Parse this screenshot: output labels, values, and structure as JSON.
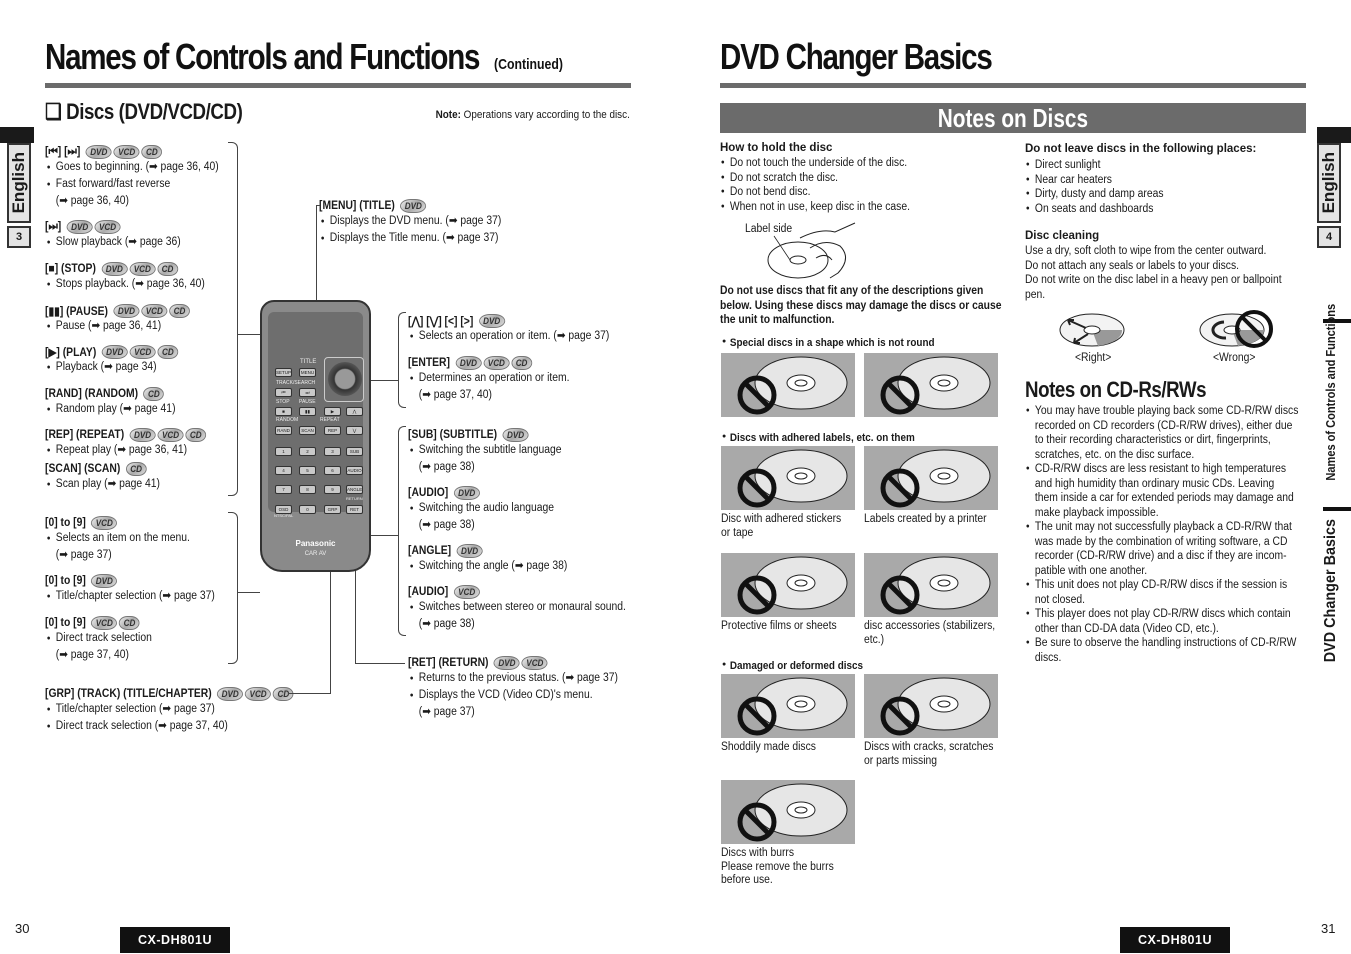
{
  "left_page": {
    "title": "Names of Controls and Functions",
    "title_suffix": "(Continued)",
    "section_title": "❑ Discs (DVD/VCD/CD)",
    "note_label": "Note:",
    "note_text": " Operations vary according to the disc.",
    "side_tab_label": "English",
    "side_tab_number": "3",
    "page_number": "30",
    "model": "CX-DH801U",
    "left_items": [
      {
        "key": "[⏮] [⏭]",
        "badges": [
          "DVD",
          "VCD",
          "CD"
        ],
        "bullets": [
          "Goes to beginning. (➡ page 36, 40)",
          "Fast forward/fast reverse",
          "(➡ page 36, 40)"
        ]
      },
      {
        "key": "[⏭]",
        "badges": [
          "DVD",
          "VCD"
        ],
        "bullets": [
          "Slow playback (➡ page 36)"
        ]
      },
      {
        "key": "[■] (STOP)",
        "badges": [
          "DVD",
          "VCD",
          "CD"
        ],
        "bullets": [
          "Stops playback. (➡ page 36, 40)"
        ]
      },
      {
        "key": "[▮▮] (PAUSE)",
        "badges": [
          "DVD",
          "VCD",
          "CD"
        ],
        "bullets": [
          "Pause (➡ page 36, 41)"
        ]
      },
      {
        "key": "[▶] (PLAY)",
        "badges": [
          "DVD",
          "VCD",
          "CD"
        ],
        "bullets": [
          "Playback (➡ page 34)"
        ]
      },
      {
        "key": "[RAND] (RANDOM)",
        "badges": [
          "CD"
        ],
        "bullets": [
          "Random play (➡ page 41)"
        ]
      },
      {
        "key": "[REP] (REPEAT)",
        "badges": [
          "DVD",
          "VCD",
          "CD"
        ],
        "bullets": [
          "Repeat play (➡ page 36, 41)"
        ]
      },
      {
        "key": "[SCAN] (SCAN)",
        "badges": [
          "CD"
        ],
        "bullets": [
          "Scan play (➡ page 41)"
        ]
      },
      {
        "key": "[0] to [9]",
        "badges": [
          "VCD"
        ],
        "bullets": [
          "Selects an item on the menu.",
          "(➡ page 37)"
        ]
      },
      {
        "key": "[0] to [9]",
        "badges": [
          "DVD"
        ],
        "bullets": [
          "Title/chapter selection (➡ page 37)"
        ]
      },
      {
        "key": "[0] to [9]",
        "badges": [
          "VCD",
          "CD"
        ],
        "bullets": [
          "Direct track selection",
          "(➡ page 37, 40)"
        ]
      },
      {
        "key": "[GRP] (TRACK) (TITLE/CHAPTER)",
        "badges": [
          "DVD",
          "VCD",
          "CD"
        ],
        "bullets": [
          "Title/chapter selection (➡ page 37)",
          "Direct track selection (➡ page 37, 40)"
        ]
      }
    ],
    "right_items": [
      {
        "key": "[MENU] (TITLE)",
        "badges": [
          "DVD"
        ],
        "bullets": [
          "Displays the DVD menu. (➡ page 37)",
          "Displays the Title menu. (➡ page 37)"
        ]
      },
      {
        "key": "[⋀] [⋁] [<] [>]",
        "badges": [
          "DVD"
        ],
        "bullets": [
          "Selects an operation or item. (➡ page 37)"
        ]
      },
      {
        "key": "[ENTER]",
        "badges": [
          "DVD",
          "VCD",
          "CD"
        ],
        "bullets": [
          "Determines an operation or item.",
          "(➡ page 37, 40)"
        ]
      },
      {
        "key": "[SUB] (SUBTITLE)",
        "badges": [
          "DVD"
        ],
        "bullets": [
          "Switching the subtitle language",
          "(➡ page 38)"
        ]
      },
      {
        "key": "[AUDIO]",
        "badges": [
          "DVD"
        ],
        "bullets": [
          "Switching the audio language",
          "(➡ page 38)"
        ]
      },
      {
        "key": "[ANGLE]",
        "badges": [
          "DVD"
        ],
        "bullets": [
          "Switching the angle (➡ page 38)"
        ]
      },
      {
        "key": "[AUDIO]",
        "badges": [
          "VCD"
        ],
        "bullets": [
          "Switches between stereo or monaural sound.",
          "(➡ page 38)"
        ]
      },
      {
        "key": "[RET] (RETURN)",
        "badges": [
          "DVD",
          "VCD"
        ],
        "bullets": [
          "Returns to the previous status. (➡ page 37)",
          "Displays the VCD (Video CD)'s menu.",
          "(➡ page 37)"
        ]
      }
    ],
    "remote": {
      "brand": "Panasonic",
      "sub": "CAR AV",
      "labels": {
        "title": "TITLE",
        "track_search": "TRACK/SEARCH",
        "stop": "STOP",
        "pause": "PAUSE",
        "random": "RANDOM",
        "repeat": "REPEAT",
        "return": "RETURN",
        "ntsc_pal": "NTSC/PAL"
      },
      "buttons": [
        "SETUP",
        "MENU",
        "⏮",
        "⏭",
        "■",
        "▮▮",
        "▶",
        "⋀",
        "RAND",
        "SCAN",
        "REP",
        "⋁",
        "1",
        "2",
        "3",
        "SUB",
        "4",
        "5",
        "6",
        "AUDIO",
        "7",
        "8",
        "9",
        "ANGLE",
        "OSD",
        "0",
        "GRP",
        "RET"
      ]
    }
  },
  "right_page": {
    "title": "DVD Changer Basics",
    "band_title": "Notes on Discs",
    "side_tab_label": "English",
    "side_tab_number": "4",
    "side_nav": [
      "Names of Controls and Functions",
      "DVD Changer Basics"
    ],
    "page_number": "31",
    "model": "CX-DH801U",
    "hold": {
      "heading": "How to hold the disc",
      "bullets": [
        "Do not touch the underside of the disc.",
        "Do not scratch the disc.",
        "Do not bend disc.",
        "When not in use, keep disc in the case."
      ],
      "figure_label": "Label side"
    },
    "warning": [
      "Do not use discs that fit any of the descriptions given",
      "below. Using these discs may damage the discs or cause",
      "the unit to malfunction."
    ],
    "groups": [
      {
        "heading": "Special discs in a shape which is not round",
        "captions": [
          "",
          ""
        ]
      },
      {
        "heading": "Discs with adhered labels, etc. on them",
        "captions": [
          "Disc with adhered stickers\nor tape",
          "Labels created by a printer"
        ]
      },
      {
        "heading": "",
        "captions": [
          "Protective films or sheets",
          "disc accessories (stabilizers,\netc.)"
        ]
      },
      {
        "heading": "Damaged or deformed discs",
        "captions": [
          "Shoddily made discs",
          "Discs with cracks, scratches\nor parts missing"
        ]
      },
      {
        "heading": "",
        "captions": [
          "Discs with burrs\nPlease remove the burrs\nbefore use."
        ]
      }
    ],
    "places": {
      "heading": "Do not leave discs in the following places:",
      "bullets": [
        "Direct sunlight",
        "Near car heaters",
        "Dirty, dusty and damp areas",
        "On seats and dashboards"
      ]
    },
    "cleaning": {
      "heading": "Disc cleaning",
      "lines": [
        "Use a dry, soft cloth to wipe from the center outward.",
        "Do not attach any seals or labels to your discs.",
        "Do not write on the disc label in a heavy pen or ballpoint",
        "pen."
      ],
      "right_label": "<Right>",
      "wrong_label": "<Wrong>"
    },
    "cdr": {
      "heading": "Notes on CD-Rs/RWs",
      "bullets": [
        [
          "You may have trouble playing back some CD-R/RW discs",
          "recorded on CD recorders (CD-R/RW drives), either due",
          "to their recording characteristics or dirt, fingerprints,",
          "scratches, etc. on the disc surface."
        ],
        [
          "CD-R/RW discs are less resistant to high temperatures",
          "and high humidity than ordinary music CDs. Leaving",
          "them inside a car for extended periods may damage and",
          "make playback impossible."
        ],
        [
          "The unit may not successfully playback a CD-R/RW that",
          "was made by the combination of writing software, a CD",
          "recorder (CD-R/RW drive) and a disc if they are incom-",
          "patible with one another."
        ],
        [
          "This unit does not play CD-R/RW discs if the session is",
          "not closed."
        ],
        [
          "This player does not play CD-R/RW discs which contain",
          "other than CD-DA data (Video CD, etc.)."
        ],
        [
          "Be sure to observe the handling instructions of CD-R/RW",
          "discs."
        ]
      ]
    }
  }
}
